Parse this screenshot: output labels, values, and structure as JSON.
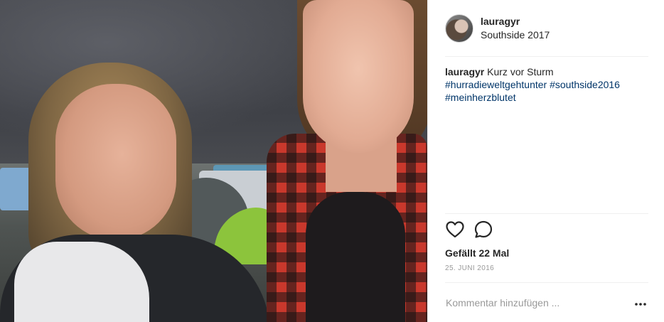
{
  "post": {
    "photo_alt": "",
    "header": {
      "username": "lauragyr",
      "location": "Southside 2017"
    },
    "caption": {
      "username": "lauragyr",
      "text": "Kurz vor Sturm",
      "hashtags": [
        "#hurradieweltgehtunter",
        "#southside2016",
        "#meinherzblutet"
      ]
    },
    "actions": {
      "like_icon": "heart-icon",
      "comment_icon": "speech-bubble-icon"
    },
    "likes_label": "Gefällt 22 Mal",
    "date": "25. JUNI 2016",
    "comment": {
      "placeholder": "Kommentar hinzufügen ...",
      "more_icon": "ellipsis-icon"
    }
  },
  "colors": {
    "hashtag": "#003569",
    "text": "#262626",
    "muted": "#999999",
    "divider": "#efefef"
  }
}
